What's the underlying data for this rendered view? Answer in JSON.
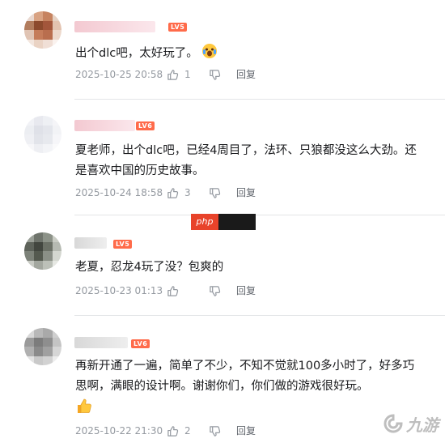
{
  "comments": [
    {
      "level": "LV5",
      "text": "出个dlc吧，太好玩了。",
      "emoji": "wow-face",
      "date": "2025-10-25 20:58",
      "likes": "1",
      "reply": "回复",
      "avatar_colors": [
        "#e9d8d0",
        "#d9a383",
        "#c68360",
        "#e6d2c4",
        "#b27d5e",
        "#8c4a2d",
        "#a3563b",
        "#e3c3b0",
        "#e0c4b4",
        "#c57c5a",
        "#b96e4e",
        "#edd9cc",
        "#f3e6de",
        "#ead3c4",
        "#f0dfd6",
        "#faf2ee"
      ]
    },
    {
      "level": "LV6",
      "text": "夏老师，出个dlc吧，已经4周目了，法环、只狼都没这么大劲。还是喜欢中国的历史故事。",
      "date": "2025-10-24 18:58",
      "likes": "3",
      "reply": "回复",
      "avatar_colors": [
        "#f1f2f6",
        "#e8e9ef",
        "#eef0f4",
        "#f5f5f8",
        "#eceef2",
        "#dfe1e8",
        "#e4e6ec",
        "#f2f3f6",
        "#eff0f4",
        "#e2e4ea",
        "#e7e9ee",
        "#f6f6f9",
        "#f7f7f9",
        "#eeeff3",
        "#f3f4f7",
        "#fafafb"
      ]
    },
    {
      "level": "LV5",
      "text": "老夏，忍龙4玩了没？包爽的",
      "date": "2025-10-23 01:13",
      "likes": "",
      "reply": "回复",
      "avatar_colors": [
        "#9a9f97",
        "#6f746c",
        "#8c9288",
        "#c9ccc4",
        "#5e635b",
        "#42463f",
        "#6b7066",
        "#b6bab2",
        "#7d8279",
        "#54594f",
        "#8a8f86",
        "#d4d7d0",
        "#c7cac3",
        "#a3a79f",
        "#bcc0b8",
        "#e6e8e3"
      ]
    },
    {
      "level": "LV6",
      "text": "再新开通了一遍，简单了不少，不知不觉就100多小时了，好多巧思啊，满眼的设计啊。谢谢你们，你们做的游戏很好玩。",
      "emoji": "thumbs-up",
      "date": "2025-10-22 21:30",
      "likes": "2",
      "reply": "回复",
      "avatar_colors": [
        "#d8d8d8",
        "#b8b8b8",
        "#a9a9a9",
        "#cfcfcf",
        "#9a9a9a",
        "#7c7c7c",
        "#8e8e8e",
        "#c4c4c4",
        "#b0b0b0",
        "#8a8a8a",
        "#a0a0a0",
        "#d6d6d6",
        "#e2e2e2",
        "#c9c9c9",
        "#d2d2d2",
        "#ededed"
      ]
    }
  ],
  "banner": {
    "badge": "php"
  },
  "watermark": {
    "text": "九游"
  },
  "colors": {
    "level_badge": "#ff6b4a",
    "meta_text": "#9499a0",
    "divider": "#e3e5e7"
  }
}
